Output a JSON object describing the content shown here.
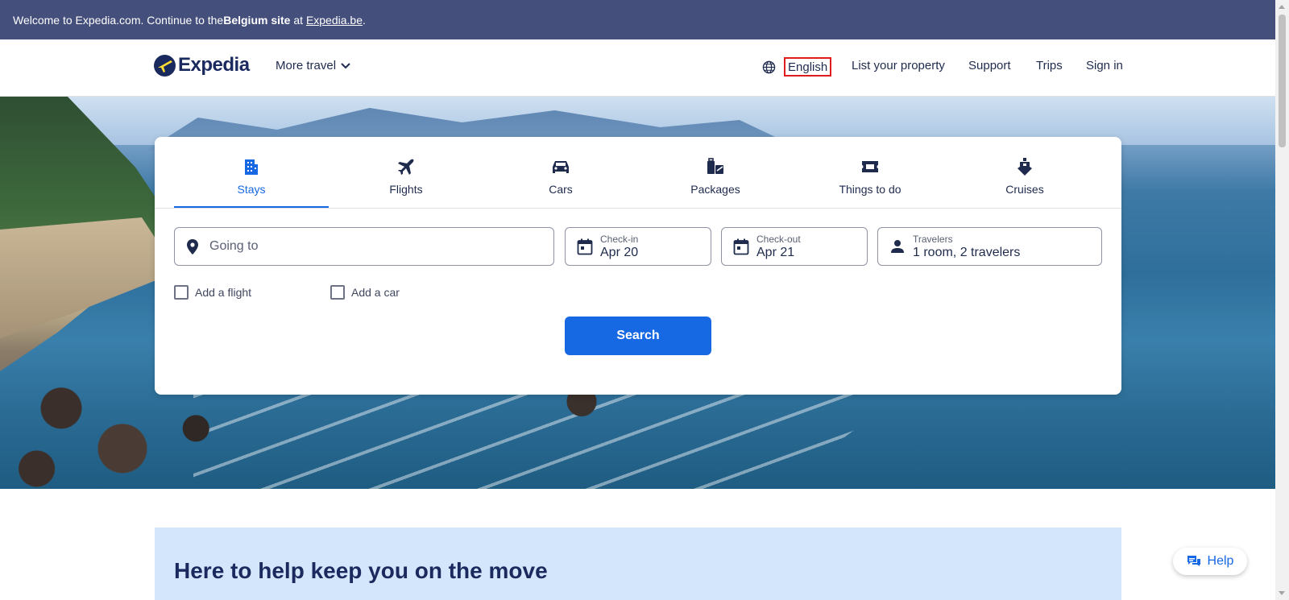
{
  "banner": {
    "prefix": "Welcome to Expedia.com. Continue to the ",
    "site_name": "Belgium site",
    "middle": " at ",
    "link": "Expedia.be",
    "suffix": "."
  },
  "header": {
    "logo_text": "Expedia",
    "more_travel": "More travel",
    "language": "English",
    "list_property": "List your property",
    "support": "Support",
    "trips": "Trips",
    "sign_in": "Sign in"
  },
  "search": {
    "tabs": [
      {
        "label": "Stays",
        "icon": "building-icon",
        "active": true
      },
      {
        "label": "Flights",
        "icon": "plane-icon"
      },
      {
        "label": "Cars",
        "icon": "car-icon"
      },
      {
        "label": "Packages",
        "icon": "luggage-icon"
      },
      {
        "label": "Things to do",
        "icon": "ticket-icon"
      },
      {
        "label": "Cruises",
        "icon": "ship-icon"
      }
    ],
    "going_to_placeholder": "Going to",
    "checkin": {
      "label": "Check-in",
      "value": "Apr 20"
    },
    "checkout": {
      "label": "Check-out",
      "value": "Apr 21"
    },
    "travelers": {
      "label": "Travelers",
      "value": "1 room, 2 travelers"
    },
    "add_flight": "Add a flight",
    "add_car": "Add a car",
    "search_button": "Search"
  },
  "help_section": {
    "title": "Here to help keep you on the move"
  },
  "help_button": "Help",
  "colors": {
    "banner": "#444f7c",
    "primary": "#1668e3",
    "navy": "#1b2a5e",
    "help_bg": "#d4e6fb",
    "highlight": "#e01b1b"
  }
}
